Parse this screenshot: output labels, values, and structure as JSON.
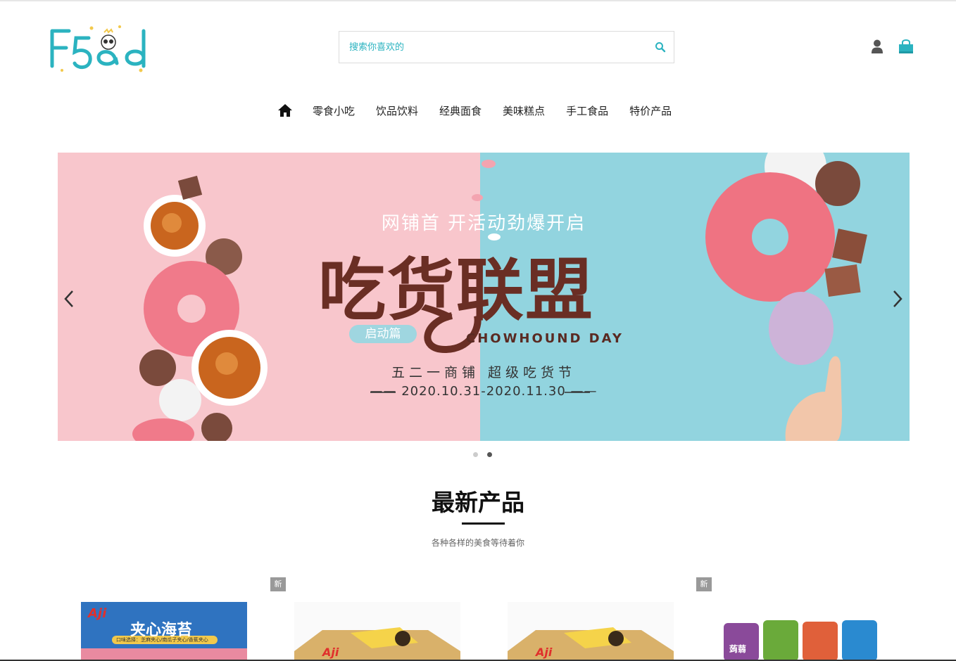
{
  "brand": {
    "logo_text": "F5ad",
    "accent": "#2bb3c0"
  },
  "search": {
    "placeholder": "搜索你喜欢的",
    "icon": "search-icon"
  },
  "header_icons": {
    "user": "user-icon",
    "cart": "shopping-bag-icon"
  },
  "nav": {
    "home_icon": "home-icon",
    "items": [
      "零食小吃",
      "饮品饮料",
      "经典面食",
      "美味糕点",
      "手工食品",
      "特价产品"
    ]
  },
  "banner": {
    "subtitle": "网铺首 开活动劲爆开启",
    "title": "吃货联盟",
    "tag": "启动篇",
    "english": "CHOWHOUND  DAY",
    "line1": "五二一商铺  超级吃货节",
    "line2": "——  2020.10.31-2020.11.30  ——",
    "colors": {
      "pink": "#f8c6cc",
      "blue": "#92d4df",
      "title": "#6a2e24"
    },
    "slide_count": 2,
    "active_slide": 2
  },
  "section": {
    "title": "最新产品",
    "subtitle": "各种各样的美食等待着你"
  },
  "products": [
    {
      "badge": "新",
      "image_text": "夹心海苔",
      "brand": "Aji",
      "caption": "口味选择：芝麻夹心/南瓜子夹心/香蕉夹心"
    },
    {
      "badge": "",
      "brand": "Aji"
    },
    {
      "badge": "",
      "brand": "Aji"
    },
    {
      "badge": "新",
      "image_text": "蒟蒻"
    }
  ]
}
